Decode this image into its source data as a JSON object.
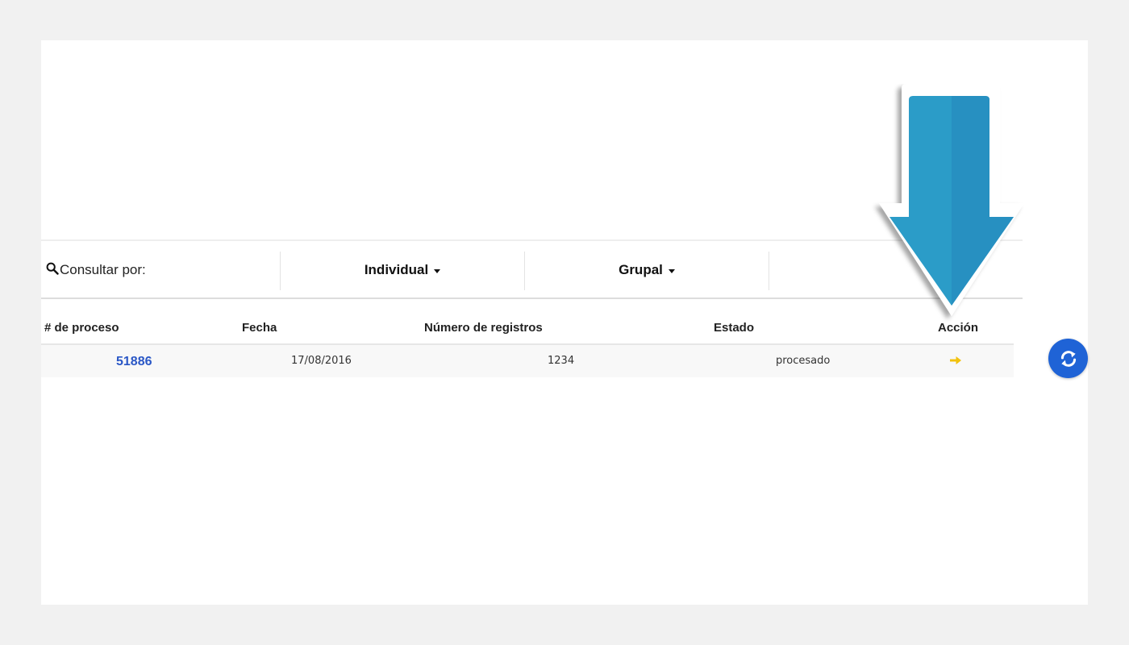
{
  "filter": {
    "consult_label": "Consultar por:",
    "dropdowns": [
      {
        "label": "Individual"
      },
      {
        "label": "Grupal"
      }
    ]
  },
  "table": {
    "headers": [
      "# de proceso",
      "Fecha",
      "Número de registros",
      "Estado",
      "Acción"
    ],
    "rows": [
      {
        "process_id": "51886",
        "date": "17/08/2016",
        "records": "1234",
        "status": "procesado"
      }
    ]
  },
  "icons": {
    "search": "search-icon",
    "action": "arrow-right-icon",
    "refresh": "refresh-icon",
    "callout": "down-arrow-callout-icon"
  },
  "colors": {
    "link": "#2a57c6",
    "action_arrow": "#f2c20e",
    "refresh_button": "#1f63d6",
    "callout_arrow": "#2b97c6"
  }
}
